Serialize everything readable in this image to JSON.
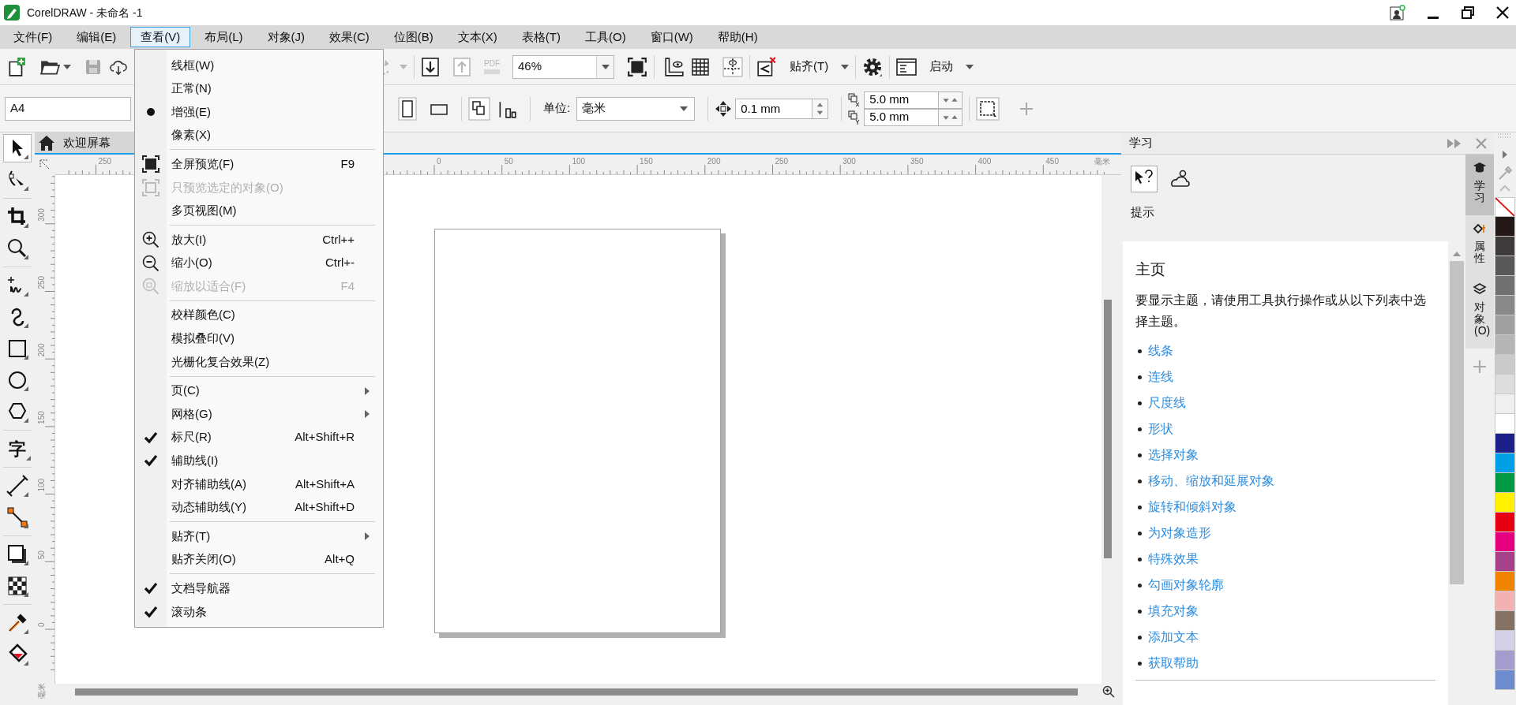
{
  "window": {
    "title": "CorelDRAW - 未命名 -1"
  },
  "menu_bar": [
    {
      "label": "文件(F)",
      "selected": false
    },
    {
      "label": "编辑(E)",
      "selected": false
    },
    {
      "label": "查看(V)",
      "selected": true
    },
    {
      "label": "布局(L)",
      "selected": false
    },
    {
      "label": "对象(J)",
      "selected": false
    },
    {
      "label": "效果(C)",
      "selected": false
    },
    {
      "label": "位图(B)",
      "selected": false
    },
    {
      "label": "文本(X)",
      "selected": false
    },
    {
      "label": "表格(T)",
      "selected": false
    },
    {
      "label": "工具(O)",
      "selected": false
    },
    {
      "label": "窗口(W)",
      "selected": false
    },
    {
      "label": "帮助(H)",
      "selected": false
    }
  ],
  "toolbar": {
    "pdf_label": "PDF",
    "zoom_level": "46%",
    "snap_label": "贴齐(T)",
    "launch_label": "启动"
  },
  "property_bar": {
    "page_size": "A4",
    "units_label": "单位:",
    "units": "毫米",
    "nudge": "0.1 mm",
    "duplicate_x": "5.0 mm",
    "duplicate_y": "5.0 mm"
  },
  "toolbox": {
    "text_tool_glyph": "字"
  },
  "document_tab": {
    "label": "欢迎屏幕"
  },
  "rulers": {
    "horizontal_labels": [
      "250",
      "0",
      "50",
      "100",
      "150",
      "200",
      "250",
      "300",
      "350",
      "400",
      "450"
    ],
    "horizontal_unit": "毫米",
    "vertical_labels": [
      "300",
      "250",
      "200",
      "150",
      "100",
      "50",
      "0"
    ],
    "vertical_unit": "毫米"
  },
  "view_menu": {
    "groups": [
      [
        {
          "label": "线框(W)",
          "kind": "radio",
          "checked": false,
          "disabled": false
        },
        {
          "label": "正常(N)",
          "kind": "radio",
          "checked": false,
          "disabled": false
        },
        {
          "label": "增强(E)",
          "kind": "radio",
          "checked": true,
          "disabled": false
        },
        {
          "label": "像素(X)",
          "kind": "radio",
          "checked": false,
          "disabled": false
        }
      ],
      [
        {
          "label": "全屏预览(F)",
          "shortcut": "F9",
          "kind": "icon",
          "disabled": false
        },
        {
          "label": "只预览选定的对象(O)",
          "kind": "icon",
          "disabled": true
        },
        {
          "label": "多页视图(M)",
          "kind": "plain",
          "disabled": false
        }
      ],
      [
        {
          "label": "放大(I)",
          "shortcut": "Ctrl++",
          "kind": "icon",
          "disabled": false
        },
        {
          "label": "缩小(O)",
          "shortcut": "Ctrl+-",
          "kind": "icon",
          "disabled": false
        },
        {
          "label": "缩放以适合(F)",
          "shortcut": "F4",
          "kind": "icon",
          "disabled": true
        }
      ],
      [
        {
          "label": "校样颜色(C)",
          "kind": "plain",
          "disabled": false
        },
        {
          "label": "模拟叠印(V)",
          "kind": "plain",
          "disabled": false
        },
        {
          "label": "光栅化复合效果(Z)",
          "kind": "plain",
          "disabled": false
        }
      ],
      [
        {
          "label": "页(C)",
          "kind": "submenu",
          "disabled": false
        },
        {
          "label": "网格(G)",
          "kind": "submenu",
          "disabled": false
        },
        {
          "label": "标尺(R)",
          "shortcut": "Alt+Shift+R",
          "kind": "check",
          "checked": true,
          "disabled": false
        },
        {
          "label": "辅助线(I)",
          "kind": "check",
          "checked": true,
          "disabled": false
        },
        {
          "label": "对齐辅助线(A)",
          "shortcut": "Alt+Shift+A",
          "kind": "check",
          "checked": false,
          "disabled": false
        },
        {
          "label": "动态辅助线(Y)",
          "shortcut": "Alt+Shift+D",
          "kind": "check",
          "checked": false,
          "disabled": false
        }
      ],
      [
        {
          "label": "贴齐(T)",
          "kind": "submenu",
          "disabled": false
        },
        {
          "label": "贴齐关闭(O)",
          "shortcut": "Alt+Q",
          "kind": "plain",
          "disabled": false
        }
      ],
      [
        {
          "label": "文档导航器",
          "kind": "check",
          "checked": true,
          "disabled": false
        },
        {
          "label": "滚动条",
          "kind": "check",
          "checked": true,
          "disabled": false
        }
      ]
    ]
  },
  "docker": {
    "title": "学习",
    "section": "提示",
    "heading": "主页",
    "intro": "要显示主题，请使用工具执行操作或从以下列表中选择主题。",
    "topics": [
      "线条",
      "连线",
      "尺度线",
      "形状",
      "选择对象",
      "移动、缩放和延展对象",
      "旋转和倾斜对象",
      "为对象造形",
      "特殊效果",
      "勾画对象轮廓",
      "填充对象",
      "添加文本",
      "获取帮助"
    ]
  },
  "docker_tabs": [
    {
      "label": "学习",
      "selected": true
    },
    {
      "label": "属性",
      "selected": false
    },
    {
      "label": "对象 (O)",
      "selected": false
    }
  ],
  "palette": [
    {
      "kind": "none"
    },
    {
      "kind": "color",
      "color": "#231815"
    },
    {
      "kind": "color",
      "color": "#3e3a39"
    },
    {
      "kind": "color",
      "color": "#595757"
    },
    {
      "kind": "color",
      "color": "#727171"
    },
    {
      "kind": "color",
      "color": "#898989"
    },
    {
      "kind": "color",
      "color": "#9fa0a0"
    },
    {
      "kind": "color",
      "color": "#b5b5b6"
    },
    {
      "kind": "color",
      "color": "#c9caca"
    },
    {
      "kind": "color",
      "color": "#dcdddd"
    },
    {
      "kind": "color",
      "color": "#efefef"
    },
    {
      "kind": "color",
      "color": "#ffffff"
    },
    {
      "kind": "color",
      "color": "#1d2088"
    },
    {
      "kind": "color",
      "color": "#00a0e9"
    },
    {
      "kind": "color",
      "color": "#009944"
    },
    {
      "kind": "color",
      "color": "#fff100"
    },
    {
      "kind": "color",
      "color": "#e60012"
    },
    {
      "kind": "color",
      "color": "#e4007f"
    },
    {
      "kind": "color",
      "color": "#a64088"
    },
    {
      "kind": "color",
      "color": "#f08300"
    },
    {
      "kind": "color",
      "color": "#f2b2b2"
    },
    {
      "kind": "color",
      "color": "#857163"
    },
    {
      "kind": "color",
      "color": "#d4d0e8"
    },
    {
      "kind": "color",
      "color": "#a59bcd"
    },
    {
      "kind": "color",
      "color": "#6d8ccd"
    }
  ]
}
